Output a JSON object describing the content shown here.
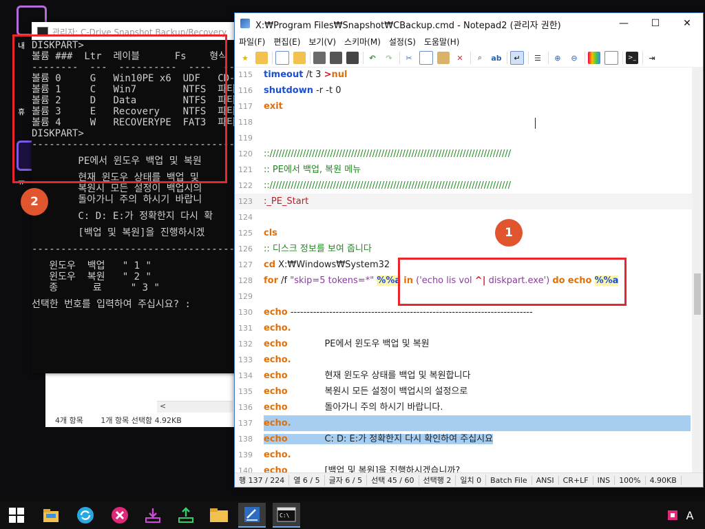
{
  "desktop": {
    "labels": [
      "내",
      "휴",
      "ㅠ"
    ]
  },
  "explorer": {
    "scroll_left": "<",
    "status_items": "4개 항목",
    "status_selected": "1개 항목 선택함 4.92KB"
  },
  "console": {
    "title": "관리자:  C-Drive Snapshot Backup/Recovery",
    "lines": [
      "DISKPART>",
      "볼륨 ###  Ltr  레이블      Fs    형식",
      "--------  ---  ----------  ----  ----",
      "볼륨 0     G   Win10PE x6  UDF   CD-R",
      "볼륨 1     C   Win7        NTFS  파티",
      "볼륨 2     D   Data        NTFS  파티",
      "볼륨 3     E   Recovery    NTFS  파티",
      "볼륨 4     W   RECOVERYPE  FAT3  파티",
      "DISKPART>",
      "-----------------------------------",
      "",
      "        PE에서 윈도우 백업 및 복원",
      "",
      "        현재 윈도우 상태를 백업 및",
      "        복원시 모든 설정이 백업시의",
      "        돌아가니 주의 하시기 바랍니",
      "",
      "        C: D: E:가 정확한지 다시 확",
      "",
      "        [백업 및 복원]을 진행하시겠",
      "",
      "-----------------------------------",
      "",
      "   윈도우  백업   \" 1 \"",
      "   윈도우  복원   \" 2 \"",
      "   종      료     \" 3 \"",
      "",
      "선택한 번호를 입력하여 주십시요? :"
    ]
  },
  "notepad": {
    "title": "X:₩Program Files₩Snapshot₩CBackup.cmd - Notepad2 (관리자 권한)",
    "window_controls": {
      "minimize": "—",
      "maximize": "☐",
      "close": "✕"
    },
    "menu": [
      "파일(F)",
      "편집(E)",
      "보기(V)",
      "스키마(M)",
      "설정(S)",
      "도움말(H)"
    ],
    "lines": [
      {
        "n": "115",
        "segs": [
          [
            "kwb",
            "timeout"
          ],
          [
            "txt",
            " /t 3 "
          ],
          [
            "op",
            ">"
          ],
          [
            "kw",
            "nul"
          ]
        ]
      },
      {
        "n": "116",
        "segs": [
          [
            "kwb",
            "shutdown"
          ],
          [
            "txt",
            " -r -t 0"
          ]
        ]
      },
      {
        "n": "117",
        "segs": [
          [
            "kw",
            "exit"
          ]
        ]
      },
      {
        "n": "118",
        "segs": []
      },
      {
        "n": "119",
        "segs": []
      },
      {
        "n": "120",
        "segs": [
          [
            "cmt",
            "::////////////////////////////////////////////////////////////////////////////////"
          ]
        ]
      },
      {
        "n": "121",
        "segs": [
          [
            "cmt",
            ":: PE에서 백업, 복원 메뉴"
          ]
        ]
      },
      {
        "n": "122",
        "segs": [
          [
            "cmt",
            "::////////////////////////////////////////////////////////////////////////////////"
          ]
        ]
      },
      {
        "n": "123",
        "segs": [
          [
            "lbl",
            ":_PE_Start"
          ]
        ]
      },
      {
        "n": "124",
        "segs": []
      },
      {
        "n": "125",
        "segs": [
          [
            "kw",
            "cls"
          ]
        ]
      },
      {
        "n": "126",
        "segs": [
          [
            "cmt",
            ":: 디스크 정보를 보여 줍니다"
          ]
        ]
      },
      {
        "n": "127",
        "segs": [
          [
            "kw",
            "cd"
          ],
          [
            "txt",
            " X:₩Windows₩System32"
          ]
        ]
      },
      {
        "n": "128",
        "segs": [
          [
            "kw",
            "for"
          ],
          [
            "txt",
            " /f "
          ],
          [
            "str",
            "\"skip=5 tokens=*\""
          ],
          [
            "txt",
            " "
          ],
          [
            "var",
            "%%a"
          ],
          [
            "txt",
            " "
          ],
          [
            "kw",
            "in"
          ],
          [
            "txt",
            " "
          ],
          [
            "str",
            "('echo lis vol "
          ],
          [
            "op",
            "^|"
          ],
          [
            "str",
            " diskpart.exe')"
          ],
          [
            "txt",
            " "
          ],
          [
            "kw",
            "do"
          ],
          [
            "txt",
            " "
          ],
          [
            "kw",
            "echo"
          ],
          [
            "txt",
            " "
          ],
          [
            "var",
            "%%a"
          ]
        ]
      },
      {
        "n": "129",
        "segs": []
      },
      {
        "n": "130",
        "segs": [
          [
            "kw",
            "echo"
          ],
          [
            "txt",
            " ---------------------------------------------------------------------------"
          ]
        ]
      },
      {
        "n": "131",
        "segs": [
          [
            "kw",
            "echo."
          ]
        ]
      },
      {
        "n": "132",
        "segs": [
          [
            "kw",
            "echo"
          ],
          [
            "txt",
            "             PE에서 윈도우 백업 및 복원"
          ]
        ]
      },
      {
        "n": "133",
        "segs": [
          [
            "kw",
            "echo."
          ]
        ]
      },
      {
        "n": "134",
        "segs": [
          [
            "kw",
            "echo"
          ],
          [
            "txt",
            "             현재 윈도우 상태를 백업 및 복원합니다"
          ]
        ]
      },
      {
        "n": "135",
        "segs": [
          [
            "kw",
            "echo"
          ],
          [
            "txt",
            "             복원시 모든 설정이 백업시의 설정으로"
          ]
        ]
      },
      {
        "n": "136",
        "segs": [
          [
            "kw",
            "echo"
          ],
          [
            "txt",
            "             돌아가니 주의 하시기 바랍니다."
          ]
        ]
      },
      {
        "n": "137",
        "segs": [
          [
            "kw",
            "echo."
          ]
        ]
      },
      {
        "n": "138",
        "segs": [
          [
            "kw",
            "echo"
          ],
          [
            "txt",
            "             C: D: E:가 정확한지 다시 확인하여 주십시요"
          ]
        ]
      },
      {
        "n": "139",
        "segs": [
          [
            "kw",
            "echo."
          ]
        ]
      },
      {
        "n": "140",
        "segs": [
          [
            "kw",
            "echo"
          ],
          [
            "txt",
            "             [백업 및 복원]을 진행하시겠습니까?"
          ]
        ]
      }
    ],
    "status": [
      "행 137 / 224",
      "열 6 / 5",
      "글자 6 / 5",
      "선택 45 / 60",
      "선택행 2",
      "일치 0",
      "Batch File",
      "ANSI",
      "CR+LF",
      "INS",
      "100%",
      "4.90KB"
    ]
  },
  "annotations": {
    "badge1": "1",
    "badge2": "2"
  },
  "taskbar": {
    "icons": [
      "start-icon",
      "explorer-icon",
      "refresh-icon",
      "close-x-icon",
      "download-icon",
      "upload-icon",
      "folder-icon",
      "notepad2-icon",
      "console-icon"
    ],
    "tray_text": "A"
  },
  "colors": {
    "annotation_red": "#e8262b",
    "badge_orange": "#e0542e",
    "selection": "#a7cdf0"
  }
}
